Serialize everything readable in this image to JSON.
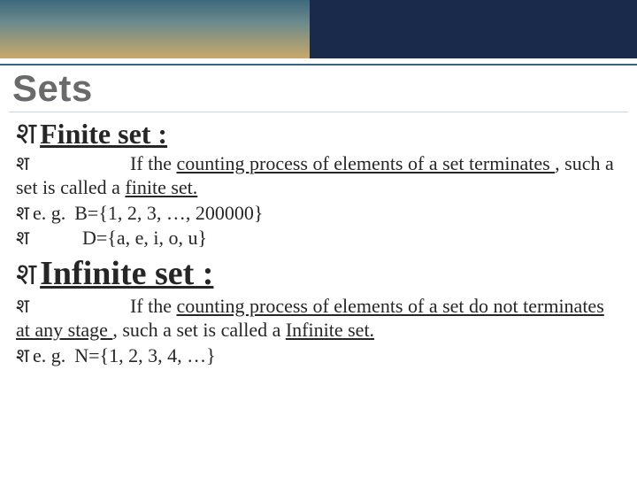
{
  "title": "Sets",
  "bullet_glyph": "श",
  "finite": {
    "heading": "Finite set :",
    "def_pre": "If the ",
    "def_u1": "counting process of elements of a set terminates ",
    "def_mid": ", such a set is called a ",
    "def_u2": "finite set.",
    "eg_label": "e. g.",
    "eg_B": "B={1, 2, 3, …, 200000}",
    "eg_D": "D={a, e, i, o, u}"
  },
  "infinite": {
    "heading": "Infinite set :",
    "def_pre": "If the ",
    "def_u1": "counting process of elements of a set do not terminates at any stage ",
    "def_mid": ", such a set is called   a ",
    "def_u2": "Infinite set.",
    "eg_label": "e. g.",
    "eg_N": "N={1, 2, 3, 4, …}"
  }
}
